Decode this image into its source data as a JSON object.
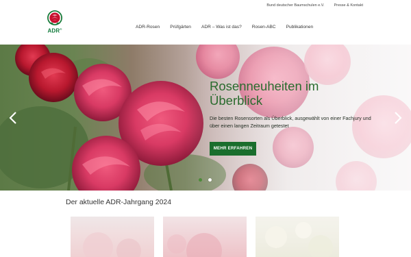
{
  "brand": {
    "logo_text": "ADR",
    "logo_reg": "®"
  },
  "util_links": [
    "Bund deutscher Baumschulen e.V.",
    "Presse & Kontakt"
  ],
  "nav": [
    "ADR-Rosen",
    "Prüfgärten",
    "ADR – Was ist das?",
    "Rosen-ABC",
    "Publikationen"
  ],
  "hero": {
    "title": "Rosenneuheiten im Überblick",
    "subtitle": "Die besten Rosensorten als Überblick, ausgewählt von einer Fachjury und über einen langen Zeitraum getestet",
    "button": "MEHR ERFAHREN",
    "slides_total": 2,
    "slide_active": 1
  },
  "section": {
    "title": "Der aktuelle ADR-Jahrgang 2024"
  },
  "colors": {
    "brand_green": "#1a6e2d",
    "heading_green": "#2a6b2e",
    "rose_red": "#c8102e"
  }
}
